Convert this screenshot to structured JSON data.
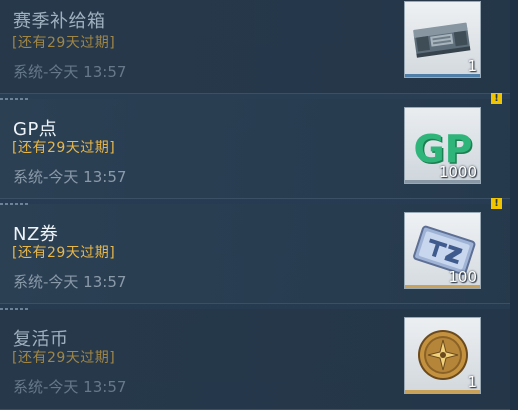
{
  "mails": [
    {
      "title": "赛季补给箱",
      "expire": "[还有29天过期]",
      "meta": "系统-今天 13:57",
      "item_icon": "supply-crate-icon",
      "quantity": "1",
      "read": true,
      "unread_badge": ""
    },
    {
      "title": "GP点",
      "expire": "[还有29天过期]",
      "meta": "系统-今天 13:57",
      "item_icon": "gp-points-icon",
      "icon_text": "GP",
      "quantity": "1000",
      "read": false,
      "unread_badge": "!"
    },
    {
      "title": "NZ券",
      "expire": "[还有29天过期]",
      "meta": "系统-今天 13:57",
      "item_icon": "nz-voucher-icon",
      "quantity": "100",
      "read": false,
      "unread_badge": "!"
    },
    {
      "title": "复活币",
      "expire": "[还有29天过期]",
      "meta": "系统-今天 13:57",
      "item_icon": "revive-coin-icon",
      "quantity": "1",
      "read": true,
      "unread_badge": ""
    }
  ],
  "colors": {
    "expire_text": "#e7b74a",
    "badge": "#f0c400",
    "slot_underline_blue": "#4f7fa8",
    "slot_underline_gold": "#c8a25a",
    "gp_green": "#2fb57a"
  }
}
